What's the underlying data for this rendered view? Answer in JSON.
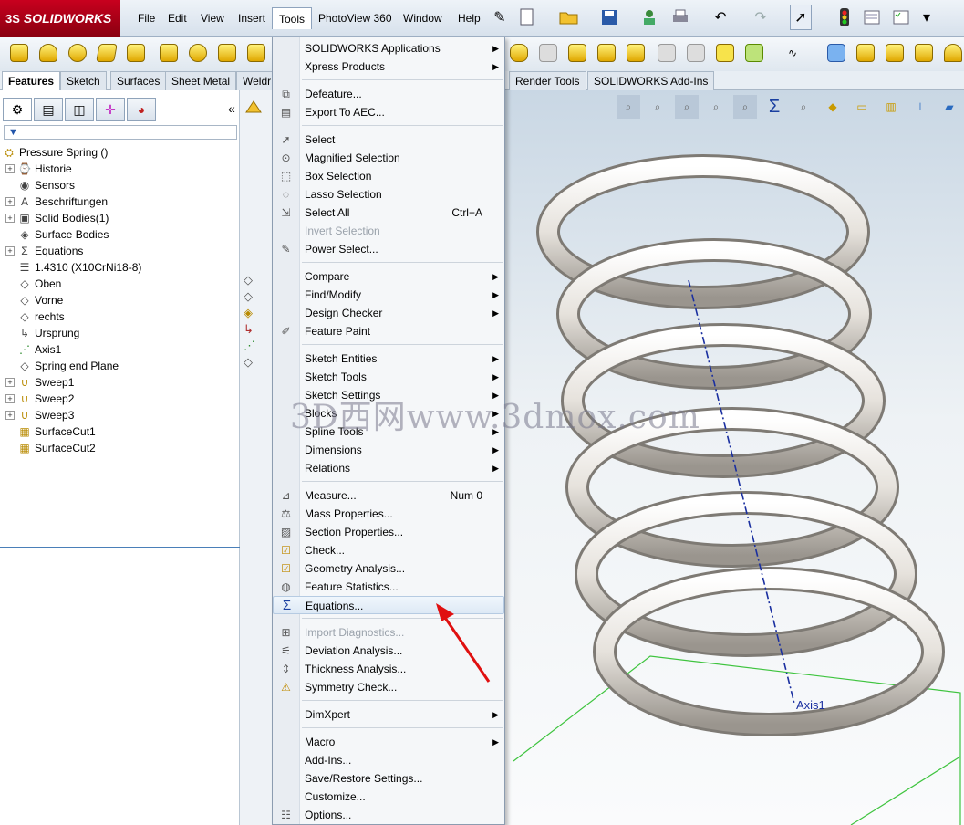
{
  "app": {
    "logo_brand": "SOLIDWORKS",
    "logo_ds": "3S"
  },
  "menubar": {
    "items": [
      "File",
      "Edit",
      "View",
      "Insert",
      "Tools",
      "PhotoView 360",
      "Window",
      "Help"
    ],
    "active": "Tools",
    "pin_icon": "pin-icon"
  },
  "tabs": {
    "items": [
      "Features",
      "Sketch",
      "Surfaces",
      "Sheet Metal",
      "Weldr"
    ],
    "right_items": [
      "Render Tools",
      "SOLIDWORKS Add-Ins"
    ],
    "active": "Features"
  },
  "filter": {
    "icon": "filter-icon"
  },
  "tree": {
    "root": "Pressure Spring  ()",
    "items": [
      {
        "label": "Historie",
        "expand": true,
        "icon": "history-icon"
      },
      {
        "label": "Sensors",
        "expand": false,
        "icon": "sensor-icon"
      },
      {
        "label": "Beschriftungen",
        "expand": true,
        "icon": "annotations-icon"
      },
      {
        "label": "Solid Bodies(1)",
        "expand": true,
        "icon": "solid-bodies-icon"
      },
      {
        "label": "Surface Bodies",
        "expand": false,
        "icon": "surface-bodies-icon"
      },
      {
        "label": "Equations",
        "expand": true,
        "icon": "equations-icon"
      },
      {
        "label": "1.4310 (X10CrNi18-8)",
        "expand": false,
        "icon": "material-icon"
      },
      {
        "label": "Oben",
        "expand": false,
        "icon": "plane-icon"
      },
      {
        "label": "Vorne",
        "expand": false,
        "icon": "plane-icon"
      },
      {
        "label": "rechts",
        "expand": false,
        "icon": "plane-icon"
      },
      {
        "label": "Ursprung",
        "expand": false,
        "icon": "origin-icon"
      },
      {
        "label": "Axis1",
        "expand": false,
        "icon": "axis-icon"
      },
      {
        "label": "Spring end Plane",
        "expand": false,
        "icon": "plane-icon"
      },
      {
        "label": "Sweep1",
        "expand": true,
        "icon": "sweep-icon"
      },
      {
        "label": "Sweep2",
        "expand": true,
        "icon": "sweep-icon"
      },
      {
        "label": "Sweep3",
        "expand": true,
        "icon": "sweep-icon"
      },
      {
        "label": "SurfaceCut1",
        "expand": false,
        "icon": "surface-cut-icon"
      },
      {
        "label": "SurfaceCut2",
        "expand": false,
        "icon": "surface-cut-icon"
      }
    ]
  },
  "tools_menu": {
    "items": [
      {
        "label": "SOLIDWORKS Applications",
        "submenu": true
      },
      {
        "label": "Xpress Products",
        "submenu": true
      },
      {
        "sep": true
      },
      {
        "label": "Defeature...",
        "icon": "defeature-icon"
      },
      {
        "label": "Export To AEC...",
        "icon": "export-aec-icon"
      },
      {
        "sep": true
      },
      {
        "label": "Select",
        "icon": "select-arrow-icon"
      },
      {
        "label": "Magnified Selection",
        "icon": "magnified-selection-icon"
      },
      {
        "label": "Box Selection",
        "icon": "box-selection-icon"
      },
      {
        "label": "Lasso Selection",
        "icon": "lasso-selection-icon"
      },
      {
        "label": "Select All",
        "shortcut": "Ctrl+A",
        "icon": "select-all-icon"
      },
      {
        "label": "Invert Selection",
        "disabled": true
      },
      {
        "label": "Power Select...",
        "icon": "power-select-icon"
      },
      {
        "sep": true
      },
      {
        "label": "Compare",
        "submenu": true
      },
      {
        "label": "Find/Modify",
        "submenu": true
      },
      {
        "label": "Design Checker",
        "submenu": true
      },
      {
        "label": "Feature Paint",
        "icon": "feature-paint-icon"
      },
      {
        "sep": true
      },
      {
        "label": "Sketch Entities",
        "submenu": true
      },
      {
        "label": "Sketch Tools",
        "submenu": true
      },
      {
        "label": "Sketch Settings",
        "submenu": true
      },
      {
        "label": "Blocks",
        "submenu": true
      },
      {
        "label": "Spline Tools",
        "submenu": true
      },
      {
        "label": "Dimensions",
        "submenu": true
      },
      {
        "label": "Relations",
        "submenu": true
      },
      {
        "sep": true
      },
      {
        "label": "Measure...",
        "shortcut": "Num 0",
        "icon": "measure-icon"
      },
      {
        "label": "Mass Properties...",
        "icon": "mass-properties-icon"
      },
      {
        "label": "Section Properties...",
        "icon": "section-properties-icon"
      },
      {
        "label": "Check...",
        "icon": "check-icon"
      },
      {
        "label": "Geometry Analysis...",
        "icon": "geometry-analysis-icon"
      },
      {
        "label": "Feature Statistics...",
        "icon": "feature-statistics-icon"
      },
      {
        "label": "Equations...",
        "icon": "sigma-icon",
        "highlight": true
      },
      {
        "sep": true
      },
      {
        "label": "Import Diagnostics...",
        "disabled": true,
        "icon": "import-diagnostics-icon"
      },
      {
        "label": "Deviation  Analysis...",
        "icon": "deviation-analysis-icon"
      },
      {
        "label": "Thickness Analysis...",
        "icon": "thickness-analysis-icon"
      },
      {
        "label": "Symmetry Check...",
        "icon": "symmetry-check-icon"
      },
      {
        "sep": true
      },
      {
        "label": "DimXpert",
        "submenu": true
      },
      {
        "sep": true
      },
      {
        "label": "Macro",
        "submenu": true
      },
      {
        "label": "Add-Ins..."
      },
      {
        "label": "Save/Restore Settings..."
      },
      {
        "label": "Customize..."
      },
      {
        "label": "Options...",
        "icon": "options-icon"
      }
    ]
  },
  "viewport": {
    "axis_label": "Axis1"
  },
  "watermark": "3D西网www.3dmox.com",
  "colors": {
    "accent_red": "#e01010",
    "logo_red": "#c8001e",
    "axis_blue": "#1a2fa0",
    "plane_green": "#3fc43f"
  }
}
